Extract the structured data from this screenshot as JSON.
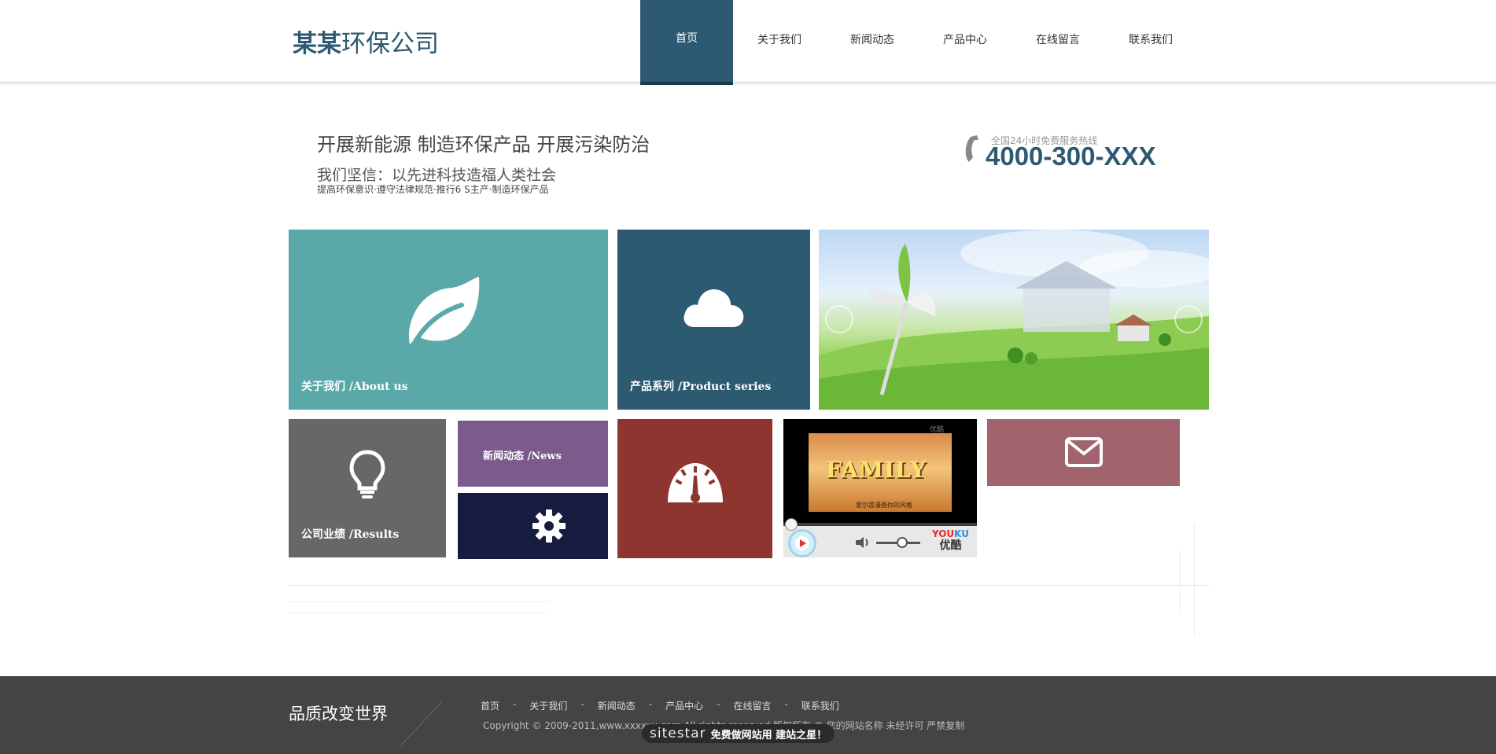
{
  "header": {
    "logo_bold": "某某",
    "logo_rest": "环保公司",
    "nav": [
      {
        "label": "首页",
        "active": true
      },
      {
        "label": "关于我们"
      },
      {
        "label": "新闻动态"
      },
      {
        "label": "产品中心"
      },
      {
        "label": "在线留言"
      },
      {
        "label": "联系我们"
      }
    ]
  },
  "intro": {
    "headline": "开展新能源 制造环保产品 开展污染防治",
    "subline": "我们坚信：以先进科技造福人类社会",
    "tagline": "提高环保意识·遵守法律规范·推行6 S主产·制造环保产品"
  },
  "hotline": {
    "label": "全国24小时免费服务热线",
    "number": "4000-300-XXX"
  },
  "tiles": {
    "about_label": "关于我们  /About us",
    "product_label": "产品系列  /Product series",
    "results_label": "公司业绩  /Results",
    "news_label": "新闻动态 /News"
  },
  "video": {
    "title": "FAMILY",
    "caption": "爱尔莲漫画你的风格",
    "watermark": "优酷",
    "brand_en_1": "YOU",
    "brand_en_2": "KU",
    "brand_cn": "优酷"
  },
  "footer": {
    "slogan": "品质改变世界",
    "links": [
      "首页",
      "关于我们",
      "新闻动态",
      "产品中心",
      "在线留言",
      "联系我们"
    ],
    "separator": "-",
    "copyright": "Copyright © 2009-2011,www.xxxxxx.com All rights reserved 版权所有 © 您的网站名称 未经许可 严禁复制",
    "sitestar_logo": "sitestar",
    "sitestar_tag": "免费做网站用 建站之星！"
  }
}
